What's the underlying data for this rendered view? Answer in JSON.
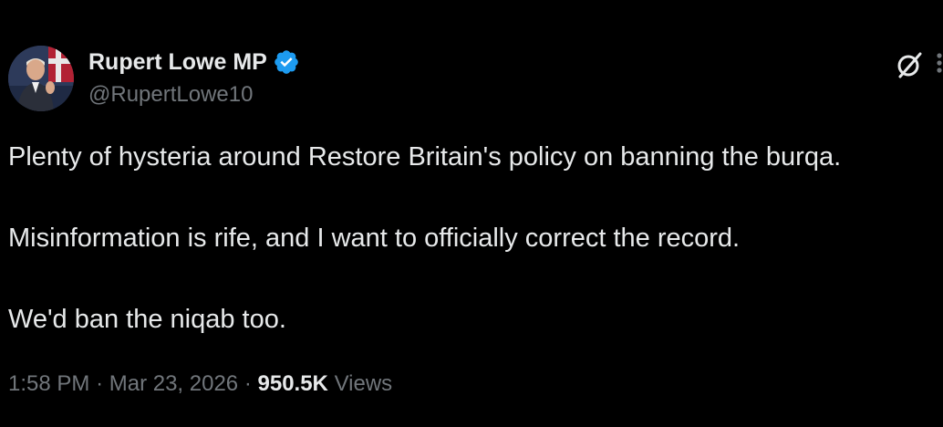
{
  "author": {
    "display_name": "Rupert Lowe MP",
    "handle": "@RupertLowe10",
    "verified_icon": "verified-badge-icon",
    "avatar_icon": "profile-photo"
  },
  "actions": {
    "grok_icon": "grok-icon",
    "more_icon": "more-options-icon"
  },
  "tweet": {
    "lines": [
      "Plenty of hysteria around Restore Britain's policy on banning the burqa.",
      "Misinformation is rife, and I want to officially correct the record.",
      "We'd ban the niqab too."
    ]
  },
  "meta": {
    "time": "1:58 PM",
    "separator": "·",
    "date": "Mar 23, 2026",
    "views_count": "950.5K",
    "views_label": "Views"
  },
  "colors": {
    "background": "#000000",
    "primary_text": "#e7e9ea",
    "secondary_text": "#71767b",
    "verified_blue": "#1d9bf0"
  }
}
